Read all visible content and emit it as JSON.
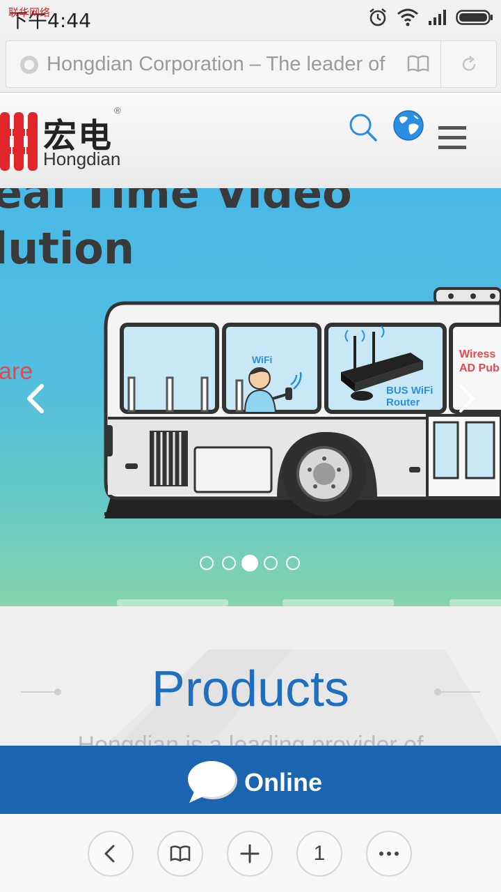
{
  "status_bar": {
    "carrier": "联华网络",
    "time": "下午4:44",
    "icons": [
      "alarm-icon",
      "wifi-icon",
      "signal-icon",
      "battery-icon"
    ]
  },
  "address_bar": {
    "url_title": "Hongdian Corporation – The leader of",
    "icons": [
      "site-icon",
      "reader-mode-icon",
      "refresh-icon"
    ]
  },
  "site_header": {
    "logo_cn": "宏电",
    "logo_reg": "®",
    "logo_en": "Hongdian",
    "icons": [
      "search-icon",
      "globe-icon",
      "menu-icon"
    ]
  },
  "banner": {
    "title_line1": "eal Time Video",
    "title_line2": "lution",
    "side_text": "are",
    "wifi_label": "WiFi",
    "router_label_1": "BUS WiFi",
    "router_label_2": "Router",
    "ad_label_1": "Wiress",
    "ad_label_2": "AD Pub",
    "slide_count": 5,
    "active_slide": 3
  },
  "products": {
    "title": "Products",
    "description": "Hongdian is a leading provider of"
  },
  "online": {
    "label": "Online"
  },
  "toolbar": {
    "tab_count": "1",
    "buttons": [
      "back-icon",
      "bookmarks-icon",
      "new-tab-icon",
      "tabs-button",
      "more-icon"
    ]
  },
  "colors": {
    "brand_blue": "#1a64b0",
    "title_blue": "#1f6fc0",
    "logo_red": "#e0262a",
    "banner_sky": "#48b8e6"
  }
}
